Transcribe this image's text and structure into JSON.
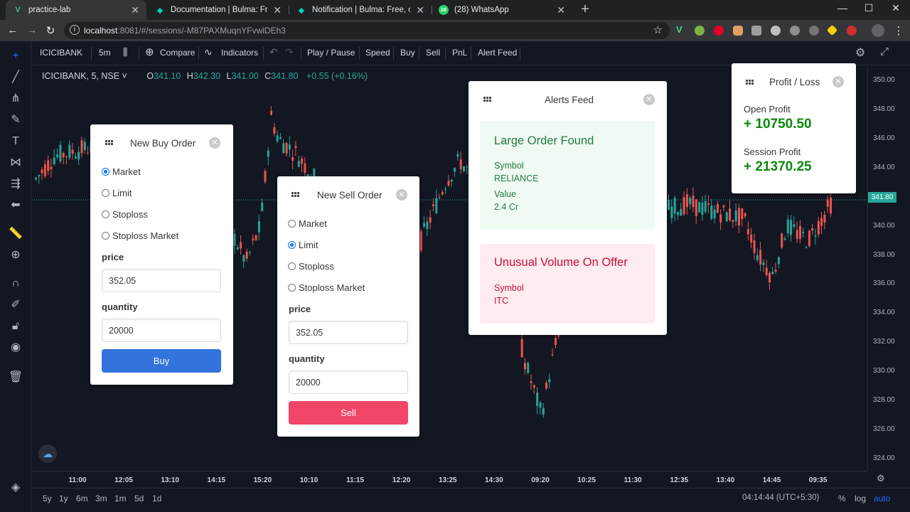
{
  "browser": {
    "tabs": [
      {
        "title": "practice-lab",
        "icon": "vue-icon",
        "glyph": "V",
        "color": "#41b883"
      },
      {
        "title": "Documentation | Bulma: Free, op",
        "icon": "bulma-icon",
        "glyph": "◆",
        "color": "#00d1b2"
      },
      {
        "title": "Notification | Bulma: Free, open s",
        "icon": "bulma-icon",
        "glyph": "◆",
        "color": "#00d1b2"
      },
      {
        "title": "(28) WhatsApp",
        "icon": "whatsapp-icon",
        "glyph": "28",
        "color": "#25d366"
      }
    ],
    "url_host": "localhost",
    "url_rest": ":8081/#/sessions/-M87PAXMuqnYFvwiDEh3"
  },
  "toolbar": {
    "symbol": "ICICIBANK",
    "interval": "5m",
    "compare": "Compare",
    "indicators": "Indicators",
    "play_pause": "Play / Pause",
    "speed": "Speed",
    "buy": "Buy",
    "sell": "Sell",
    "pnl": "PnL",
    "alert_feed": "Alert Feed"
  },
  "legend": {
    "title": "ICICIBANK, 5, NSE",
    "o_label": "O",
    "o": "341.10",
    "h_label": "H",
    "h": "342.30",
    "l_label": "L",
    "l": "341.00",
    "c_label": "C",
    "c": "341.80",
    "change": "+0.55 (+0.16%)"
  },
  "chart_data": {
    "type": "candlestick",
    "y_ticks": [
      "350.00",
      "348.00",
      "346.00",
      "344.00",
      "342.00",
      "340.00",
      "338.00",
      "336.00",
      "334.00",
      "332.00",
      "330.00",
      "328.00",
      "326.00",
      "324.00"
    ],
    "ylim": [
      323.2,
      351
    ],
    "x_ticks": [
      "11:00",
      "12:05",
      "13:10",
      "14:15",
      "15:20",
      "10:10",
      "11:15",
      "12:20",
      "13:25",
      "14:30",
      "09:20",
      "10:25",
      "11:30",
      "12:35",
      "13:40",
      "14:45",
      "09:35"
    ],
    "last_price": "341.80",
    "colors": {
      "up": "#26a69a",
      "down": "#ef5350"
    }
  },
  "bottom": {
    "ranges": [
      "5y",
      "1y",
      "6m",
      "3m",
      "1m",
      "5d",
      "1d"
    ],
    "clock": "04:14:44 (UTC+5:30)",
    "percent": "%",
    "log": "log",
    "auto": "auto"
  },
  "buy_panel": {
    "title": "New Buy Order",
    "options": [
      "Market",
      "Limit",
      "Stoploss",
      "Stoploss Market"
    ],
    "selected": "Market",
    "price_label": "price",
    "price": "352.05",
    "quantity_label": "quantity",
    "quantity": "20000",
    "button": "Buy"
  },
  "sell_panel": {
    "title": "New Sell Order",
    "options": [
      "Market",
      "Limit",
      "Stoploss",
      "Stoploss Market"
    ],
    "selected": "Limit",
    "price_label": "price",
    "price": "352.05",
    "quantity_label": "quantity",
    "quantity": "20000",
    "button": "Sell"
  },
  "alerts_panel": {
    "title": "Alerts Feed",
    "alerts": [
      {
        "title": "Large Order Found",
        "symbol_label": "Symbol",
        "symbol": "RELIANCE",
        "value_label": "Value",
        "value": "2.4 Cr"
      },
      {
        "title": "Unusual Volume On Offer",
        "symbol_label": "Symbol",
        "symbol": "ITC"
      }
    ]
  },
  "pnl_panel": {
    "title": "Profit / Loss",
    "open_label": "Open Profit",
    "open_value": "+ 10750.50",
    "session_label": "Session Profit",
    "session_value": "+ 21370.25"
  },
  "colors": {
    "buy": "#3273dc",
    "sell": "#f14668",
    "profit": "#0a8a0a",
    "success_bg": "#effaf3",
    "success_text": "#257942",
    "danger_bg": "#feecf0",
    "danger_text": "#cc0f35"
  }
}
